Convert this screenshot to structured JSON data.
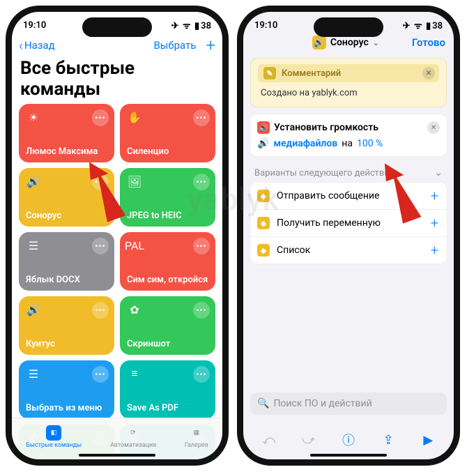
{
  "watermark": "yablyk",
  "statusbar": {
    "time": "19:10",
    "battery": "38"
  },
  "left": {
    "back": "Назад",
    "select": "Выбрать",
    "title": "Все быстрые команды",
    "cards": [
      {
        "label": "Люмос Максима",
        "color": "#f55246",
        "icon": "sun-icon"
      },
      {
        "label": "Силенцио",
        "color": "#f55246",
        "icon": "hand-icon"
      },
      {
        "label": "Сонорус",
        "color": "#f0bc29",
        "icon": "speaker-icon"
      },
      {
        "label": "JPEG to HEIC",
        "color": "#34c759",
        "icon": "images-icon"
      },
      {
        "label": "Яблык DOCX",
        "color": "#8e8e93",
        "icon": "stack-icon"
      },
      {
        "label": "Сим сим, откройся",
        "color": "#f55246",
        "icon": "pal-icon"
      },
      {
        "label": "Куитус",
        "color": "#f0bc29",
        "icon": "speaker-icon"
      },
      {
        "label": "Скриншот",
        "color": "#34c759",
        "icon": "photos-icon"
      },
      {
        "label": "Выбрать из меню",
        "color": "#1e9df0",
        "icon": "stack-icon"
      },
      {
        "label": "Save As PDF",
        "color": "#00bfb3",
        "icon": "bars-icon"
      },
      {
        "label": "",
        "color": "#34c759",
        "icon": "phone-icon"
      },
      {
        "label": "",
        "color": "#00bfb3",
        "icon": "wave-icon"
      }
    ],
    "tabs": {
      "shortcuts": "Быстрые команды",
      "automation": "Автоматизация",
      "gallery": "Галерея"
    }
  },
  "right": {
    "chip_label": "Сонорус",
    "done": "Готово",
    "comment": {
      "title": "Комментарий",
      "body": "Создано на yablyk.com"
    },
    "action": {
      "set_label": "Установить громкость",
      "media_label": "медиафайлов",
      "na": "на",
      "value": "100 %"
    },
    "next_header": "Варианты следующего действия",
    "suggestions": [
      {
        "label": "Отправить сообщение",
        "color": "#f0bc29"
      },
      {
        "label": "Получить переменную",
        "color": "#f0bc29"
      },
      {
        "label": "Список",
        "color": "#f0bc29"
      }
    ],
    "search_placeholder": "Поиск ПО и действий"
  }
}
